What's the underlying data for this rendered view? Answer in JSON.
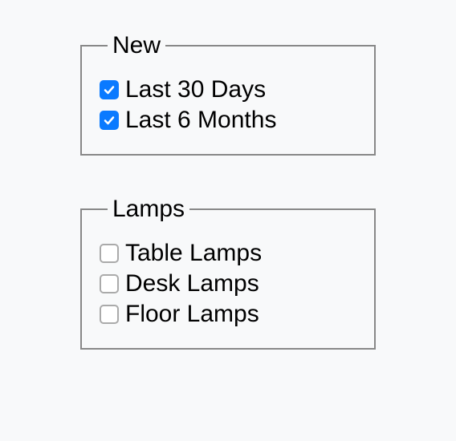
{
  "groups": [
    {
      "legend": "New",
      "items": [
        {
          "label": "Last 30 Days",
          "checked": true
        },
        {
          "label": "Last 6 Months",
          "checked": true
        }
      ]
    },
    {
      "legend": "Lamps",
      "items": [
        {
          "label": "Table Lamps",
          "checked": false
        },
        {
          "label": "Desk Lamps",
          "checked": false
        },
        {
          "label": "Floor Lamps",
          "checked": false
        }
      ]
    }
  ]
}
